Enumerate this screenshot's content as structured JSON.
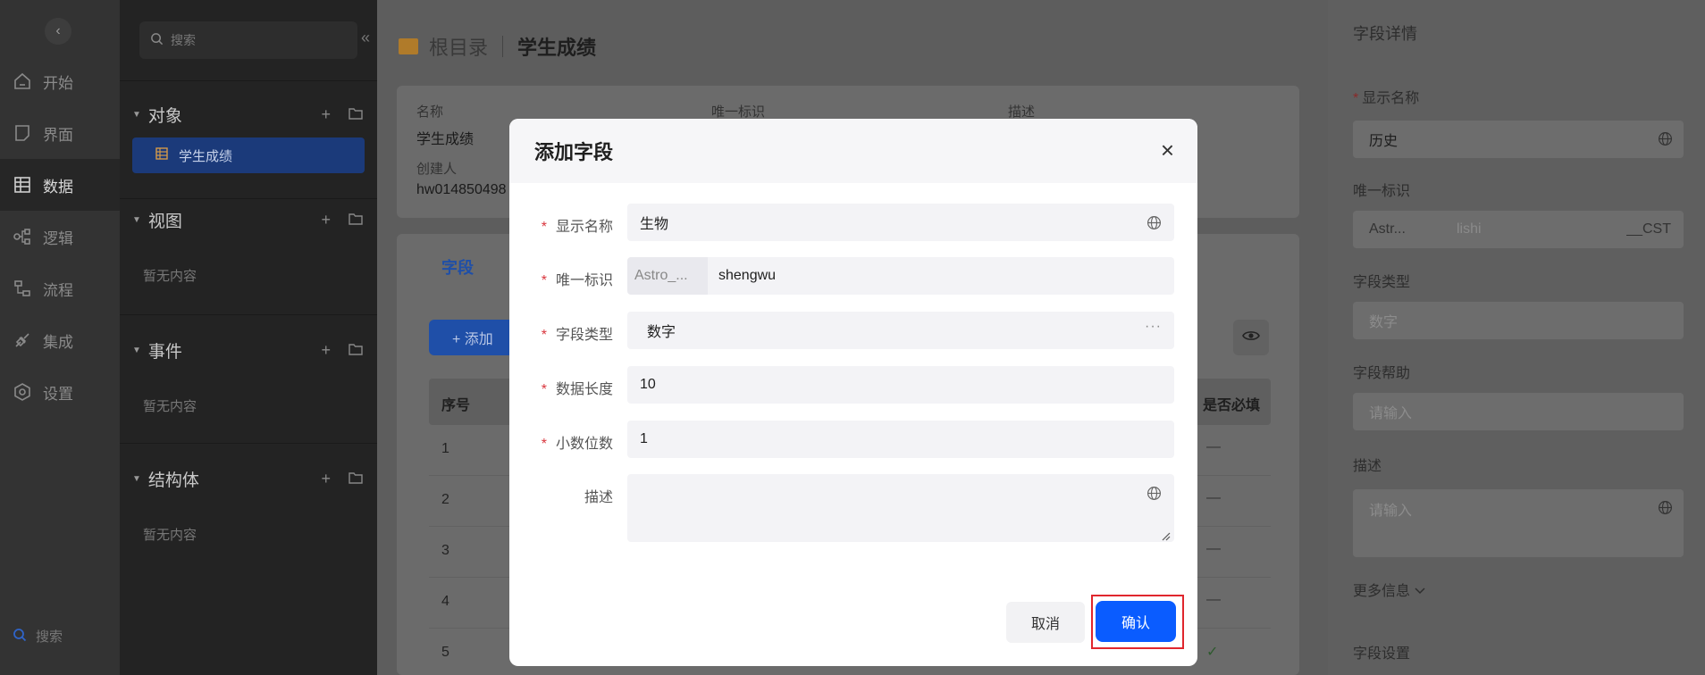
{
  "rail": {
    "items": [
      {
        "label": "开始",
        "icon": "home-icon"
      },
      {
        "label": "界面",
        "icon": "page-icon"
      },
      {
        "label": "数据",
        "icon": "table-icon"
      },
      {
        "label": "逻辑",
        "icon": "logic-icon"
      },
      {
        "label": "流程",
        "icon": "flow-icon"
      },
      {
        "label": "集成",
        "icon": "plug-icon"
      },
      {
        "label": "设置",
        "icon": "gear-icon"
      }
    ],
    "active": "数据",
    "bottom_search": "搜索"
  },
  "tree": {
    "search_placeholder": "搜索",
    "sections": [
      {
        "title": "对象",
        "items": [
          "学生成绩"
        ]
      },
      {
        "title": "视图",
        "empty": "暂无内容"
      },
      {
        "title": "事件",
        "empty": "暂无内容"
      },
      {
        "title": "结构体",
        "empty": "暂无内容"
      }
    ]
  },
  "main": {
    "breadcrumb": {
      "root": "根目录",
      "current": "学生成绩"
    },
    "info": {
      "name_label": "名称",
      "name_value": "学生成绩",
      "id_label": "唯一标识",
      "desc_label": "描述",
      "creator_label": "创建人",
      "creator_value": "hw014850498"
    },
    "fields_tab": "字段",
    "add_button": "+ 添加",
    "table": {
      "headers": [
        "序号",
        "是否必填"
      ],
      "rows": [
        {
          "no": "1",
          "required": "—"
        },
        {
          "no": "2",
          "required": "—"
        },
        {
          "no": "3",
          "required": "—"
        },
        {
          "no": "4",
          "required": "—"
        },
        {
          "no": "5",
          "required": "✓"
        }
      ]
    }
  },
  "detail": {
    "title": "字段详情",
    "display_name_label": "显示名称",
    "display_name_value": "历史",
    "unique_id_label": "唯一标识",
    "unique_id_prefix": "Astr...",
    "unique_id_value": "lishi",
    "unique_id_suffix": "__CST",
    "field_type_label": "字段类型",
    "field_type_value": "数字",
    "help_label": "字段帮助",
    "help_placeholder": "请输入",
    "desc_label": "描述",
    "desc_placeholder": "请输入",
    "more_info": "更多信息",
    "field_settings": "字段设置"
  },
  "modal": {
    "title": "添加字段",
    "fields": {
      "display_name": {
        "label": "显示名称",
        "value": "生物"
      },
      "unique_id": {
        "label": "唯一标识",
        "prefix": "Astro_...",
        "value": "shengwu"
      },
      "field_type": {
        "label": "字段类型",
        "value": "数字"
      },
      "data_length": {
        "label": "数据长度",
        "value": "10"
      },
      "decimals": {
        "label": "小数位数",
        "value": "1"
      },
      "description": {
        "label": "描述",
        "value": ""
      }
    },
    "cancel": "取消",
    "confirm": "确认"
  },
  "colors": {
    "accent": "#0a5cff",
    "required_star": "#d9363e",
    "highlight_box": "#e0262d"
  }
}
